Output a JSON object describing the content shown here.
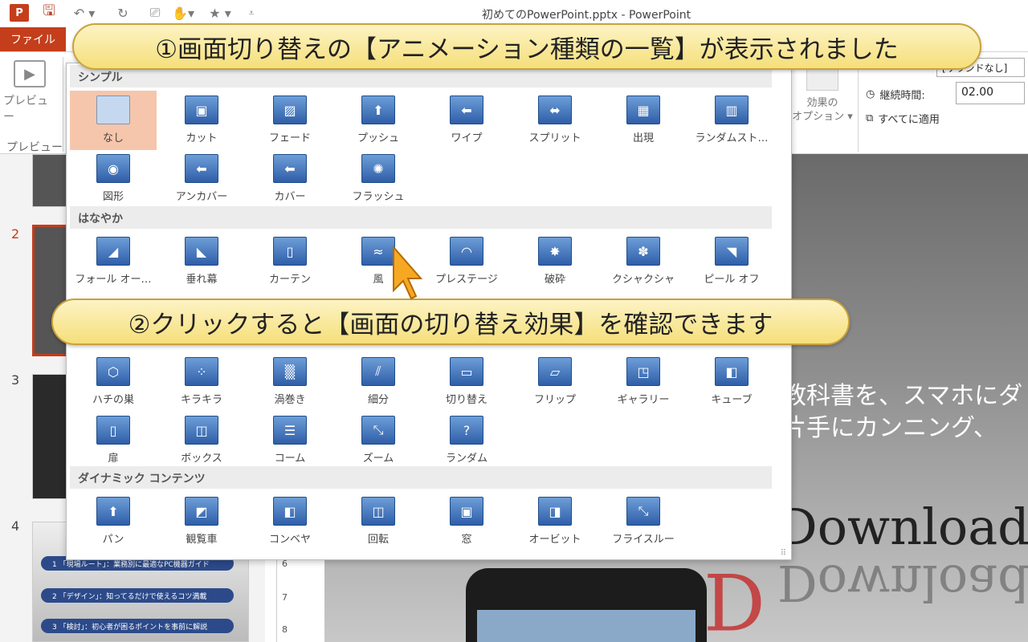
{
  "window": {
    "doc_title": "初めてのPowerPoint.pptx - PowerPoint",
    "logo": "P"
  },
  "qat": {
    "save_icon": "save-icon",
    "undo_icon": "undo-icon",
    "redo_icon": "redo-icon",
    "present_icon": "present-icon",
    "touch_icon": "touch-mode-icon",
    "star_icon": "star-icon",
    "more_icon": "customize-qat-icon",
    "glyphs": {
      "save": "🖫",
      "undo": "↶ ▾",
      "redo": "↻",
      "present": "⎚",
      "touch": "✋▾",
      "star": "★ ▾",
      "more": "⩡"
    }
  },
  "ribbon": {
    "file_tab": "ファイル",
    "preview_label": "プレビュー",
    "preview_group": "プレビュー",
    "effect_options": "効果の\nオプション ▾",
    "sound_label": "[サウンドなし]",
    "duration_label": "継続時間:",
    "duration_value": "02.00",
    "apply_all_label": "すべてに適用"
  },
  "dropdown": {
    "sections": [
      {
        "title": "シンプル",
        "items": [
          {
            "label": "なし",
            "glyph": "",
            "selected": true
          },
          {
            "label": "カット",
            "glyph": "▣"
          },
          {
            "label": "フェード",
            "glyph": "▨"
          },
          {
            "label": "プッシュ",
            "glyph": "⬆"
          },
          {
            "label": "ワイプ",
            "glyph": "⬅"
          },
          {
            "label": "スプリット",
            "glyph": "⬌"
          },
          {
            "label": "出現",
            "glyph": "▦"
          },
          {
            "label": "ランダムスト…",
            "glyph": "▥"
          },
          {
            "label": "図形",
            "glyph": "◉"
          },
          {
            "label": "アンカバー",
            "glyph": "⬅"
          },
          {
            "label": "カバー",
            "glyph": "⬅"
          },
          {
            "label": "フラッシュ",
            "glyph": "✺"
          }
        ]
      },
      {
        "title": "はなやか",
        "items": [
          {
            "label": "フォール オー…",
            "glyph": "◢"
          },
          {
            "label": "垂れ幕",
            "glyph": "◣"
          },
          {
            "label": "カーテン",
            "glyph": "▯"
          },
          {
            "label": "風",
            "glyph": "≈"
          },
          {
            "label": "プレステージ",
            "glyph": "◠"
          },
          {
            "label": "破砕",
            "glyph": "✸"
          },
          {
            "label": "クシャクシャ",
            "glyph": "✽"
          },
          {
            "label": "ピール オフ",
            "glyph": "◥"
          }
        ]
      },
      {
        "title": "",
        "items": [
          {
            "label": "ハチの巣",
            "glyph": "⬡"
          },
          {
            "label": "キラキラ",
            "glyph": "⁘"
          },
          {
            "label": "渦巻き",
            "glyph": "▒"
          },
          {
            "label": "細分",
            "glyph": "⫽"
          },
          {
            "label": "切り替え",
            "glyph": "▭"
          },
          {
            "label": "フリップ",
            "glyph": "▱"
          },
          {
            "label": "ギャラリー",
            "glyph": "◳"
          },
          {
            "label": "キューブ",
            "glyph": "◧"
          },
          {
            "label": "扉",
            "glyph": "▯"
          },
          {
            "label": "ボックス",
            "glyph": "◫"
          },
          {
            "label": "コーム",
            "glyph": "☰"
          },
          {
            "label": "ズーム",
            "glyph": "⤡"
          },
          {
            "label": "ランダム",
            "glyph": "?"
          }
        ]
      },
      {
        "title": "ダイナミック コンテンツ",
        "items": [
          {
            "label": "パン",
            "glyph": "⬆"
          },
          {
            "label": "観覧車",
            "glyph": "◩"
          },
          {
            "label": "コンベヤ",
            "glyph": "◧"
          },
          {
            "label": "回転",
            "glyph": "◫"
          },
          {
            "label": "窓",
            "glyph": "▣"
          },
          {
            "label": "オービット",
            "glyph": "◨"
          },
          {
            "label": "フライスルー",
            "glyph": "⤡"
          }
        ]
      }
    ]
  },
  "slides": {
    "numbers": [
      "2",
      "3",
      "4"
    ],
    "thumb4_bars": [
      "1 「現場ルート」：業務別に最適なPC機器ガイド",
      "2 「デザイン」：知ってるだけで使えるコツ満載",
      "3 「検討」：初心者が困るポイントを事前に解説"
    ]
  },
  "ruler": [
    "6",
    "7",
    "8"
  ],
  "slide_canvas": {
    "text1": "教科書を、スマホにダ",
    "text2": "片手にカンニング、",
    "download": "Download",
    "download_reflection": "Download"
  },
  "callouts": {
    "first": "①画面切り替えの【アニメーション種類の一覧】が表示されました",
    "second": "②クリックすると【画面の切り替え効果】を確認できます"
  },
  "colors": {
    "brand": "#c43e1c",
    "selected_tile": "#f6c6ac",
    "callout_fill": "#f9e79a",
    "icon_blue": "#2f5ea8"
  }
}
